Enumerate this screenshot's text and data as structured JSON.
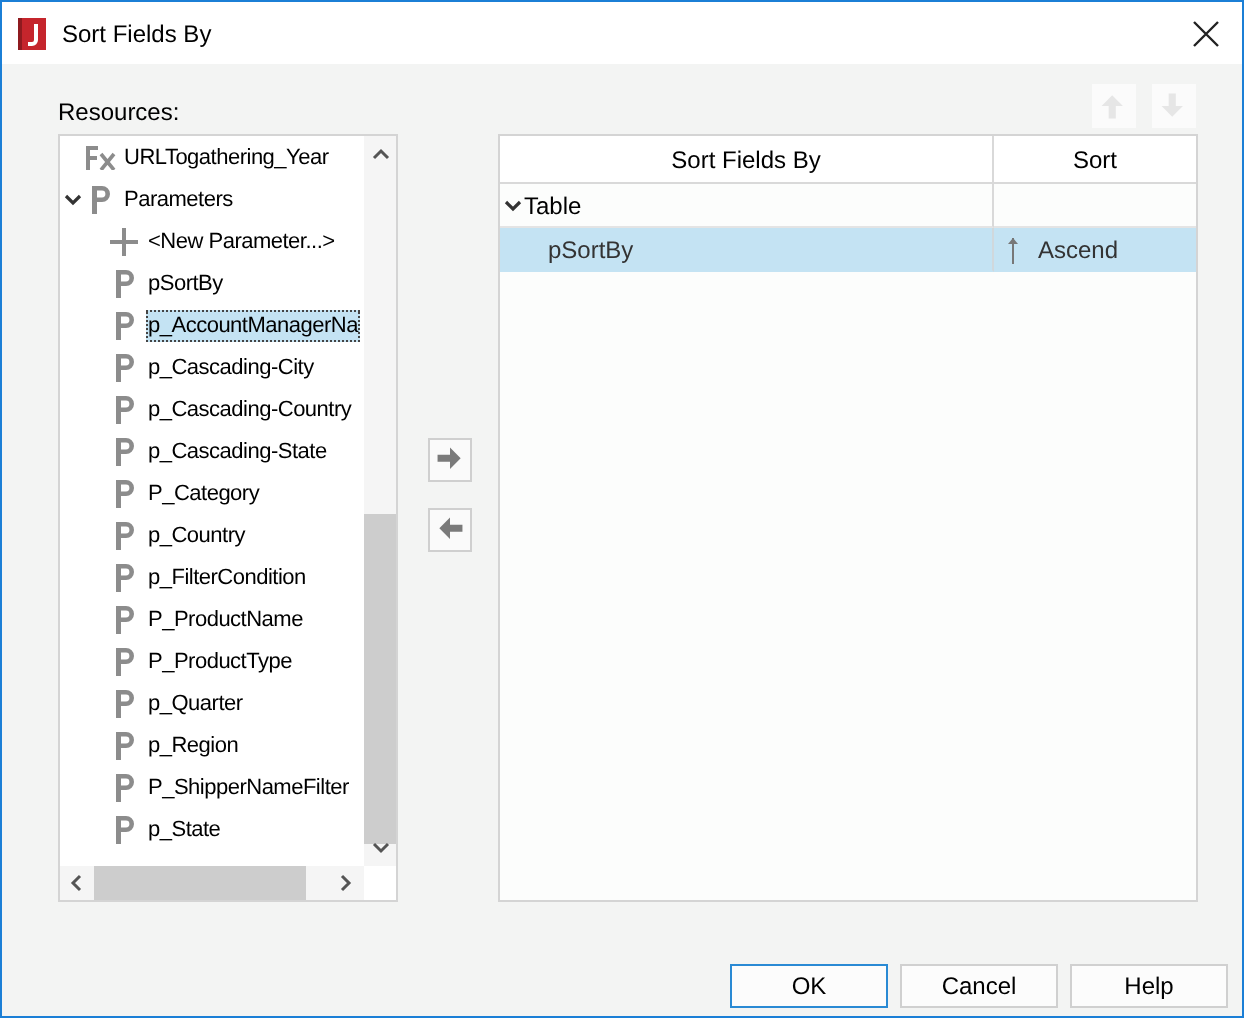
{
  "window": {
    "title": "Sort Fields By"
  },
  "resources": {
    "label": "Resources:",
    "items": [
      {
        "label": "URLTogathering_Year",
        "kind": "formula",
        "selected": false
      },
      {
        "label": "Parameters",
        "kind": "parameter",
        "selected": false,
        "expanded": true,
        "children": [
          {
            "label": "<New Parameter...>",
            "kind": "add",
            "selected": false
          },
          {
            "label": "pSortBy",
            "kind": "parameter",
            "selected": false
          },
          {
            "label": "p_AccountManagerNa",
            "kind": "parameter",
            "selected": true
          },
          {
            "label": "p_Cascading-City",
            "kind": "parameter",
            "selected": false
          },
          {
            "label": "p_Cascading-Country",
            "kind": "parameter",
            "selected": false
          },
          {
            "label": "p_Cascading-State",
            "kind": "parameter",
            "selected": false
          },
          {
            "label": "P_Category",
            "kind": "parameter",
            "selected": false
          },
          {
            "label": "p_Country",
            "kind": "parameter",
            "selected": false
          },
          {
            "label": "p_FilterCondition",
            "kind": "parameter",
            "selected": false
          },
          {
            "label": "P_ProductName",
            "kind": "parameter",
            "selected": false
          },
          {
            "label": "P_ProductType",
            "kind": "parameter",
            "selected": false
          },
          {
            "label": "p_Quarter",
            "kind": "parameter",
            "selected": false
          },
          {
            "label": "p_Region",
            "kind": "parameter",
            "selected": false
          },
          {
            "label": "P_ShipperNameFilter",
            "kind": "parameter",
            "selected": false
          },
          {
            "label": "p_State",
            "kind": "parameter",
            "selected": false
          }
        ]
      }
    ]
  },
  "move_buttons": [
    {
      "kind": "add",
      "disabled": false
    },
    {
      "kind": "remove",
      "disabled": false
    }
  ],
  "order_buttons": [
    {
      "kind": "up",
      "disabled": true
    },
    {
      "kind": "down",
      "disabled": true
    }
  ],
  "sort_table": {
    "columns": [
      "Sort Fields By",
      "Sort"
    ],
    "groups": [
      {
        "label": "Table",
        "expanded": true,
        "rows": [
          {
            "field": "pSortBy",
            "sort": "Ascend",
            "selected": true
          }
        ]
      }
    ]
  },
  "buttons": [
    {
      "label": "OK",
      "default": true
    },
    {
      "label": "Cancel",
      "default": false
    },
    {
      "label": "Help",
      "default": false
    }
  ]
}
